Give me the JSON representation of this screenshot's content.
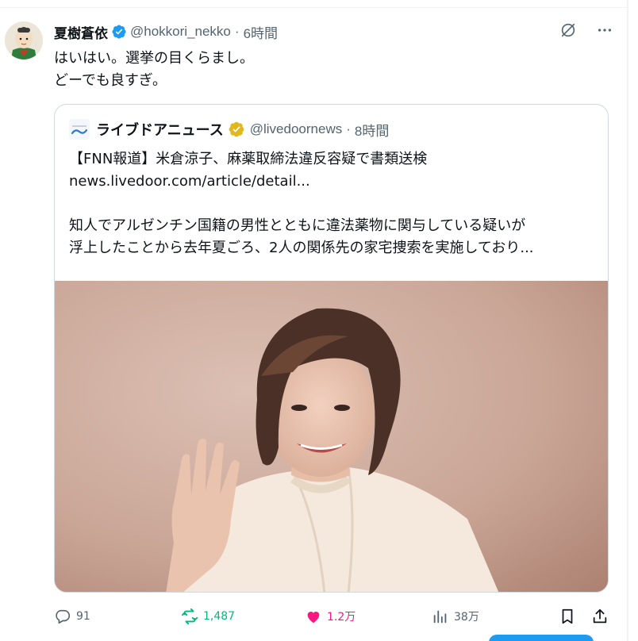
{
  "author": {
    "name": "夏樹蒼依",
    "handle": "@hokkori_nekko",
    "separator": "·",
    "time": "6時間"
  },
  "tweet": {
    "lines": [
      "はいはい。選挙の目くらまし。",
      "どーでも良すぎ。"
    ]
  },
  "quote": {
    "name": "ライブドアニュース",
    "handle": "@livedoornews",
    "separator": "·",
    "time": "8時間",
    "lines": [
      "【FNN報道】米倉涼子、麻薬取締法違反容疑で書類送検",
      "news.livedoor.com/article/detail...",
      "",
      "知人でアルゼンチン国籍の男性とともに違法薬物に関与している疑いが",
      "浮上したことから去年夏ごろ、2人の関係先の家宅捜索を実施しており..."
    ]
  },
  "actions": {
    "replies": "91",
    "reposts": "1,487",
    "likes": "1.2万",
    "views": "38万"
  },
  "colors": {
    "text": "#0f1419",
    "muted": "#536471",
    "border": "#cfd9de",
    "verified_blue": "#1d9bf0",
    "verified_gold": "#e2b719",
    "repost_green": "#00ba7c",
    "like_pink": "#f91880"
  },
  "icons": [
    "verified-badge-icon",
    "grok-icon",
    "more-icon",
    "reply-icon",
    "repost-icon",
    "like-icon",
    "views-icon",
    "bookmark-icon",
    "share-icon"
  ]
}
